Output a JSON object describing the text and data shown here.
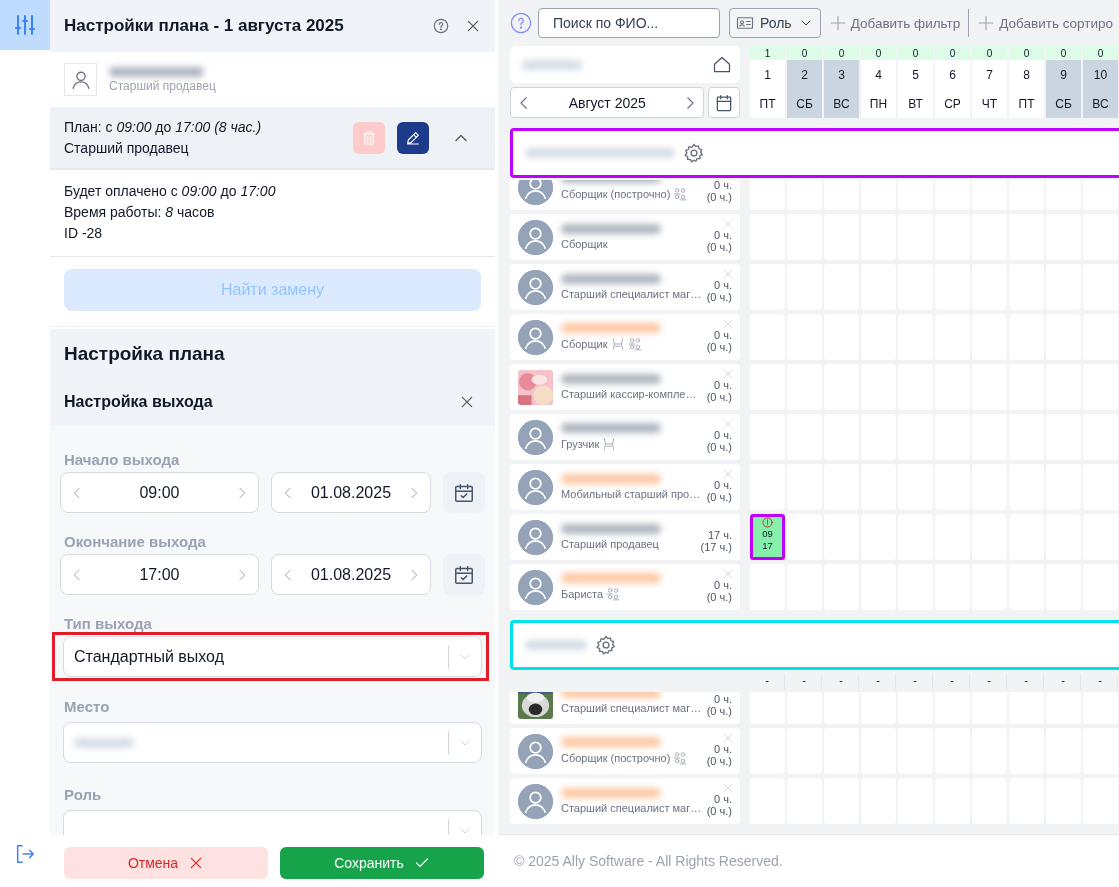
{
  "sidebar": {
    "items": [
      {
        "kind": "filter",
        "selected": true
      },
      {
        "kind": "logout",
        "selected": false
      }
    ]
  },
  "panel": {
    "title": "Настройки плана - 1 августа 2025",
    "employee": {
      "role": "Старший продавец"
    },
    "plan": {
      "summary": "План: с *09:00* до *17:00 (8 час.)*",
      "role": "Старший продавец",
      "expanded": true
    },
    "details": [
      "Будет оплачено с *09:00* до *17:00*",
      "Время работы: *8* часов",
      "ID -28"
    ],
    "replace_button": {
      "label": "Найти замену",
      "disabled": true
    },
    "section_title": "Настройка плана",
    "subsection_title": "Настройка выхода",
    "fields": [
      {
        "kind": "datetime",
        "label": "Начало выхода",
        "time": "09:00",
        "date": "01.08.2025"
      },
      {
        "kind": "datetime",
        "label": "Окончание выхода",
        "time": "17:00",
        "date": "01.08.2025"
      },
      {
        "kind": "select",
        "label": "Тип выхода",
        "value": "Стандартный выход",
        "highlighted": true
      },
      {
        "kind": "select",
        "label": "Место",
        "redacted": true,
        "highlighted": false
      },
      {
        "kind": "select",
        "label": "Роль",
        "highlighted": false
      }
    ],
    "cancel_button": "Отмена",
    "save_button": "Сохранить"
  },
  "toolbar": {
    "search_placeholder": "Поиск по ФИО...",
    "role_filter": "Роль",
    "add_filter": "Добавить фильтр",
    "add_sort": "Добавить сортиро"
  },
  "calendar": {
    "month": "Август 2025",
    "days": [
      {
        "count": "1",
        "number": "1",
        "weekday": "ПТ",
        "weekend": false
      },
      {
        "count": "0",
        "number": "2",
        "weekday": "СБ",
        "weekend": true
      },
      {
        "count": "0",
        "number": "3",
        "weekday": "ВС",
        "weekend": true
      },
      {
        "count": "0",
        "number": "4",
        "weekday": "ПН",
        "weekend": false
      },
      {
        "count": "0",
        "number": "5",
        "weekday": "ВТ",
        "weekend": false
      },
      {
        "count": "0",
        "number": "6",
        "weekday": "СР",
        "weekend": false
      },
      {
        "count": "0",
        "number": "7",
        "weekday": "ЧТ",
        "weekend": false
      },
      {
        "count": "0",
        "number": "8",
        "weekday": "ПТ",
        "weekend": false
      },
      {
        "count": "0",
        "number": "9",
        "weekday": "СБ",
        "weekend": true
      },
      {
        "count": "0",
        "number": "10",
        "weekday": "ВС",
        "weekend": true
      }
    ]
  },
  "groups": [
    {
      "color": "#c000ff",
      "employees": [
        {
          "photo_avatar": false,
          "name_highlighted": false,
          "role": "Сборщик (построчно)",
          "seat_badge": false,
          "group_badge": true,
          "hours": "0 ч.",
          "planned": "(0 ч.)",
          "removable": false
        },
        {
          "photo_avatar": false,
          "name_highlighted": false,
          "role": "Сборщик",
          "seat_badge": false,
          "group_badge": false,
          "hours": "0 ч.",
          "planned": "(0 ч.)",
          "removable": true
        },
        {
          "photo_avatar": false,
          "name_highlighted": false,
          "role": "Старший специалист маг…",
          "seat_badge": false,
          "group_badge": false,
          "hours": "0 ч.",
          "planned": "(0 ч.)",
          "removable": true
        },
        {
          "photo_avatar": false,
          "name_highlighted": true,
          "role": "Сборщик",
          "seat_badge": true,
          "group_badge": true,
          "hours": "0 ч.",
          "planned": "(0 ч.)",
          "removable": true
        },
        {
          "photo_avatar": true,
          "name_highlighted": false,
          "role": "Старший кассир-компле…",
          "seat_badge": false,
          "group_badge": false,
          "hours": "0 ч.",
          "planned": "(0 ч.)",
          "removable": true
        },
        {
          "photo_avatar": false,
          "name_highlighted": false,
          "role": "Грузчик",
          "seat_badge": true,
          "group_badge": false,
          "hours": "0 ч.",
          "planned": "(0 ч.)",
          "removable": true
        },
        {
          "photo_avatar": false,
          "name_highlighted": true,
          "role": "Мобильный старший про…",
          "seat_badge": false,
          "group_badge": false,
          "hours": "0 ч.",
          "planned": "(0 ч.)",
          "removable": true
        },
        {
          "photo_avatar": false,
          "name_highlighted": false,
          "role": "Старший продавец",
          "seat_badge": false,
          "group_badge": false,
          "hours": "17 ч.",
          "planned": "(17 ч.)",
          "removable": false,
          "cells": [
            {
              "shift": true,
              "start": "09",
              "end": "17",
              "warning": true
            },
            {
              "shift": false
            },
            {
              "shift": false
            },
            {
              "shift": false
            },
            {
              "shift": false
            },
            {
              "shift": false
            },
            {
              "shift": false
            },
            {
              "shift": false
            },
            {
              "shift": false
            },
            {
              "shift": false
            }
          ]
        },
        {
          "photo_avatar": false,
          "name_highlighted": true,
          "role": "Бариста",
          "seat_badge": false,
          "group_badge": true,
          "hours": "0 ч.",
          "planned": "(0 ч.)",
          "removable": true
        }
      ]
    },
    {
      "color": "#00e1ee",
      "summary": [
        "-",
        "-",
        "-",
        "-",
        "-",
        "-",
        "-",
        "-",
        "-",
        "-"
      ],
      "employees": [
        {
          "photo_avatar": true,
          "name_highlighted": true,
          "role": "Старший специалист маг…",
          "seat_badge": false,
          "group_badge": false,
          "hours": "0 ч.",
          "planned": "(0 ч.)",
          "removable": false
        },
        {
          "photo_avatar": false,
          "name_highlighted": true,
          "role": "Сборщик (построчно)",
          "seat_badge": false,
          "group_badge": true,
          "hours": "0 ч.",
          "planned": "(0 ч.)",
          "removable": true
        },
        {
          "photo_avatar": false,
          "name_highlighted": true,
          "role": "Старший специалист маг…",
          "seat_badge": false,
          "group_badge": false,
          "hours": "0 ч.",
          "planned": "(0 ч.)",
          "removable": true
        }
      ]
    }
  ],
  "footer": "© 2025 Ally Software - All Rights Reserved."
}
